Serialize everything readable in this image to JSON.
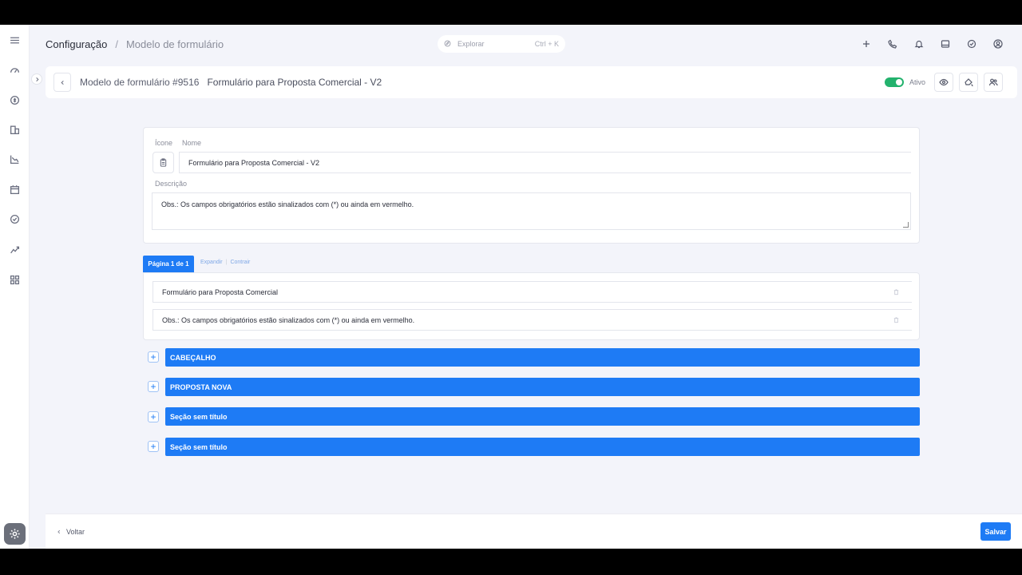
{
  "breadcrumb": {
    "root": "Configuração",
    "separator": "/",
    "current": "Modelo de formulário"
  },
  "search": {
    "placeholder": "Explorar",
    "shortcut": "Ctrl + K"
  },
  "header": {
    "model_label": "Modelo de formulário #9516",
    "form_name": "Formulário para Proposta Comercial - V2",
    "status_label": "Ativo",
    "status_on": true
  },
  "form": {
    "icon_label": "Ícone",
    "name_label": "Nome",
    "name_value": "Formulário para Proposta Comercial - V2",
    "description_label": "Descrição",
    "description_value": "Obs.: Os campos obrigatórios estão sinalizados com (*) ou ainda em vermelho."
  },
  "pages": {
    "active_tab": "Página 1 de 1",
    "expand_label": "Expandir",
    "collapse_label": "Contrair",
    "items": [
      {
        "text": "Formulário para Proposta Comercial"
      },
      {
        "text": "Obs.: Os campos obrigatórios estão sinalizados com (*) ou ainda em vermelho."
      }
    ]
  },
  "sections": [
    {
      "title": "CABEÇALHO"
    },
    {
      "title": "PROPOSTA NOVA"
    },
    {
      "title": "Seção sem título"
    },
    {
      "title": "Seção sem título"
    }
  ],
  "footer": {
    "back_label": "Voltar",
    "save_label": "Salvar"
  },
  "colors": {
    "accent": "#1e7bf5",
    "active_toggle": "#23b26d"
  },
  "icons": {
    "sidebar": [
      "menu-icon",
      "dashboard-icon",
      "finance-icon",
      "building-icon",
      "chart-icon",
      "calendar-icon",
      "check-circle-icon",
      "trend-icon",
      "apps-icon",
      "gear-icon"
    ],
    "topbar": [
      "plus-icon",
      "phone-icon",
      "bell-icon",
      "inbox-icon",
      "check-icon",
      "user-avatar-icon"
    ],
    "header": [
      "eye-icon",
      "paint-bucket-icon",
      "users-icon"
    ]
  }
}
